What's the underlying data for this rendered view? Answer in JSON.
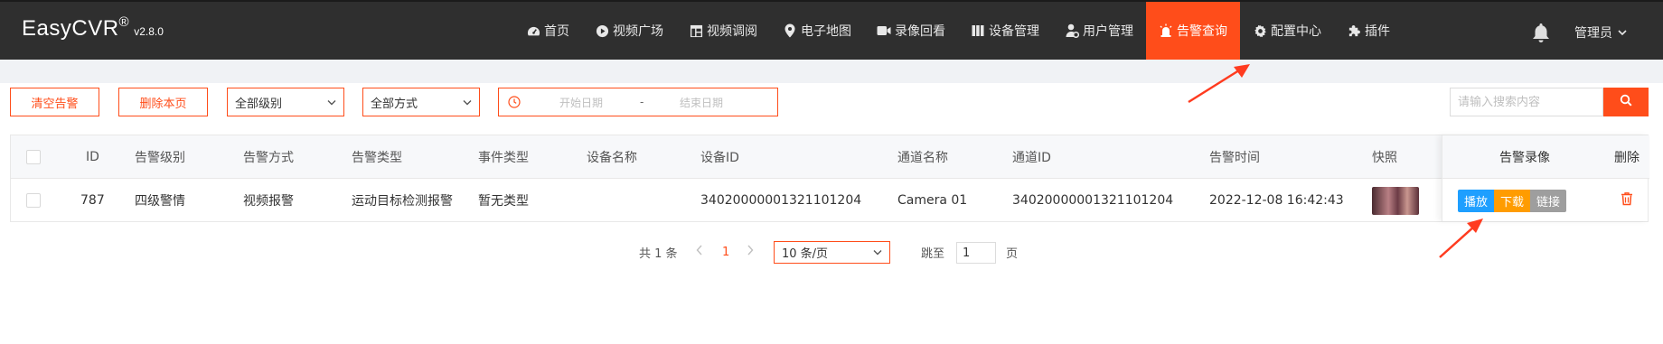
{
  "header": {
    "brand": "EasyCVR",
    "brand_mark": "®",
    "version": "v2.8.0",
    "nav": [
      {
        "label": "首页",
        "icon": "dashboard-icon"
      },
      {
        "label": "视频广场",
        "icon": "play-circle-icon"
      },
      {
        "label": "视频调阅",
        "icon": "grid-layout-icon"
      },
      {
        "label": "电子地图",
        "icon": "map-pin-icon"
      },
      {
        "label": "录像回看",
        "icon": "video-camera-icon"
      },
      {
        "label": "设备管理",
        "icon": "columns-icon"
      },
      {
        "label": "用户管理",
        "icon": "user-gear-icon"
      },
      {
        "label": "告警查询",
        "icon": "alarm-light-icon",
        "active": true
      },
      {
        "label": "配置中心",
        "icon": "gear-icon"
      },
      {
        "label": "插件",
        "icon": "puzzle-icon"
      }
    ],
    "user": "管理员"
  },
  "toolbar": {
    "clear_label": "清空告警",
    "delete_page_label": "删除本页",
    "level_select": "全部级别",
    "method_select": "全部方式",
    "start_date_placeholder": "开始日期",
    "date_sep": "-",
    "end_date_placeholder": "结束日期",
    "search_placeholder": "请输入搜索内容"
  },
  "table": {
    "headers": {
      "id": "ID",
      "level": "告警级别",
      "method": "告警方式",
      "type": "告警类型",
      "event": "事件类型",
      "device_name": "设备名称",
      "device_id": "设备ID",
      "channel_name": "通道名称",
      "channel_id": "通道ID",
      "time": "告警时间",
      "snapshot": "快照",
      "recording": "告警录像",
      "delete": "删除"
    },
    "rows": [
      {
        "id": "787",
        "level": "四级警情",
        "method": "视频报警",
        "type": "运动目标检测报警",
        "event": "暂无类型",
        "device_name": "",
        "device_id": "34020000001321101204",
        "channel_name": "Camera 01",
        "channel_id": "34020000001321101204",
        "time": "2022-12-08 16:42:43",
        "actions": {
          "play": "播放",
          "download": "下载",
          "link": "链接"
        }
      }
    ]
  },
  "pagination": {
    "total": "共 1 条",
    "current_page": "1",
    "page_size": "10 条/页",
    "jump_label": "跳至",
    "jump_value": "1",
    "page_unit": "页"
  },
  "colors": {
    "accent": "#ff4d1a",
    "header_bg": "#2f2f2f",
    "play": "#1e9fff",
    "download": "#ff9c00",
    "link": "#9e9e9e",
    "annotation_arrow": "#ff3b1f"
  }
}
